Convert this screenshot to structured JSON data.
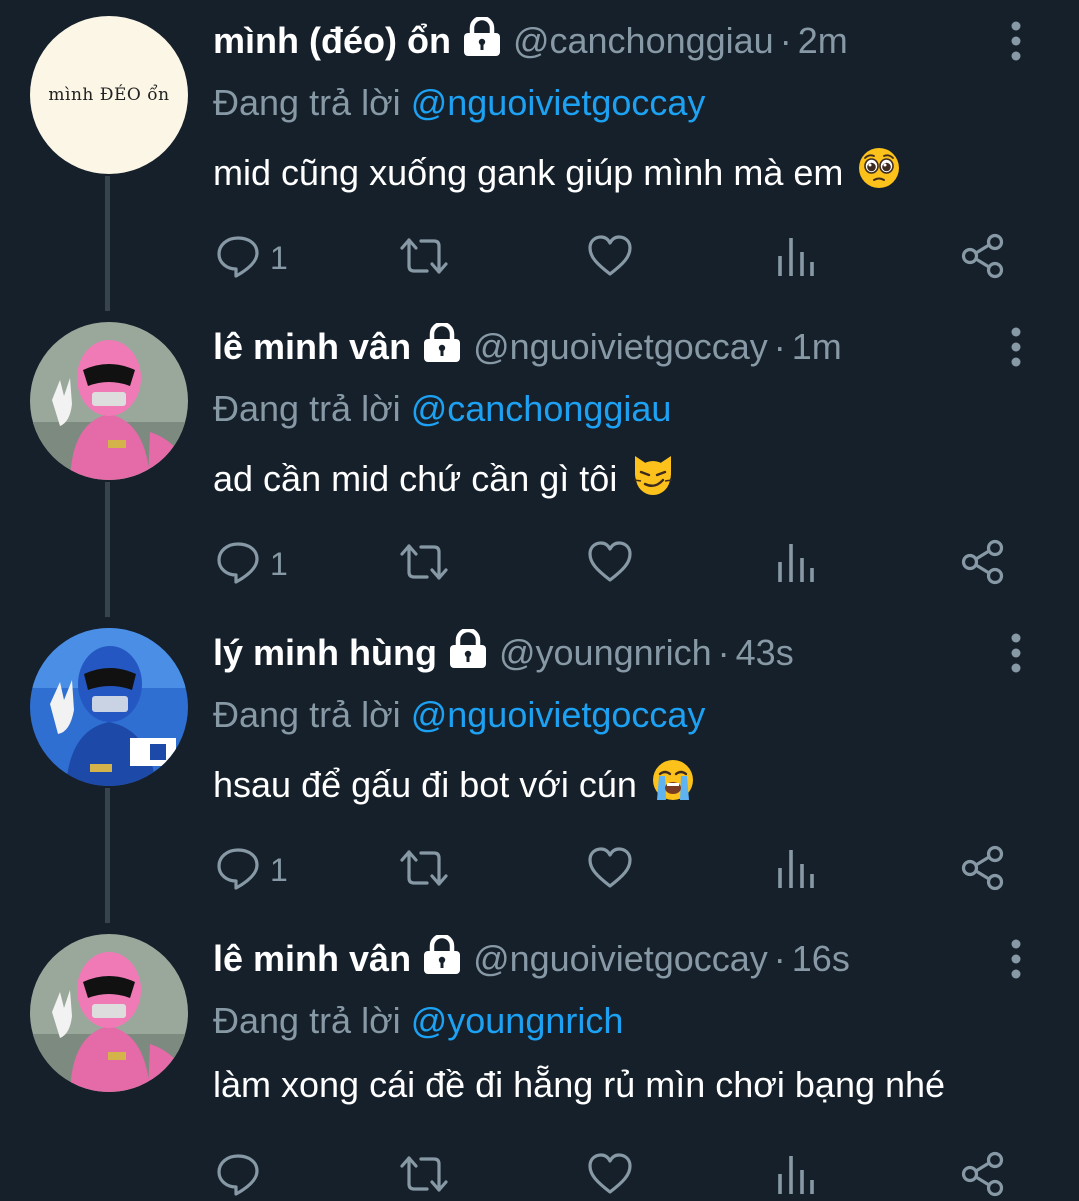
{
  "colors": {
    "background": "#15202b",
    "name": "#ffffff",
    "secondary": "#8899a6",
    "mention": "#1da1f2",
    "thread_line": "#38444d"
  },
  "reply_prefix": "Đang trả lời",
  "tweets": [
    {
      "name": "mình (đéo) ổn",
      "handle": "@canchonggiau",
      "separator": "·",
      "time": "2m",
      "reply_to": "@nguoivietgoccay",
      "text": "mid cũng xuống gank giúp mình mà em",
      "emoji": "pleading-face",
      "avatar_text": "mình ĐÉO ổn",
      "reply_count": "1"
    },
    {
      "name": "lê minh vân",
      "handle": "@nguoivietgoccay",
      "separator": "·",
      "time": "1m",
      "reply_to": "@canchonggiau",
      "text": "ad cần mid chứ cần gì tôi",
      "emoji": "smirking-cat",
      "reply_count": "1"
    },
    {
      "name": "lý minh hùng",
      "handle": "@youngnrich",
      "separator": "·",
      "time": "43s",
      "reply_to": "@nguoivietgoccay",
      "text": "hsau để gấu đi bot với cún",
      "emoji": "loudly-crying-face",
      "reply_count": "1"
    },
    {
      "name": "lê minh vân",
      "handle": "@nguoivietgoccay",
      "separator": "·",
      "time": "16s",
      "reply_to": "@youngnrich",
      "text": "làm xong cái đề đi hẵng rủ mìn chơi bạng nhé",
      "emoji": "",
      "reply_count": ""
    }
  ]
}
